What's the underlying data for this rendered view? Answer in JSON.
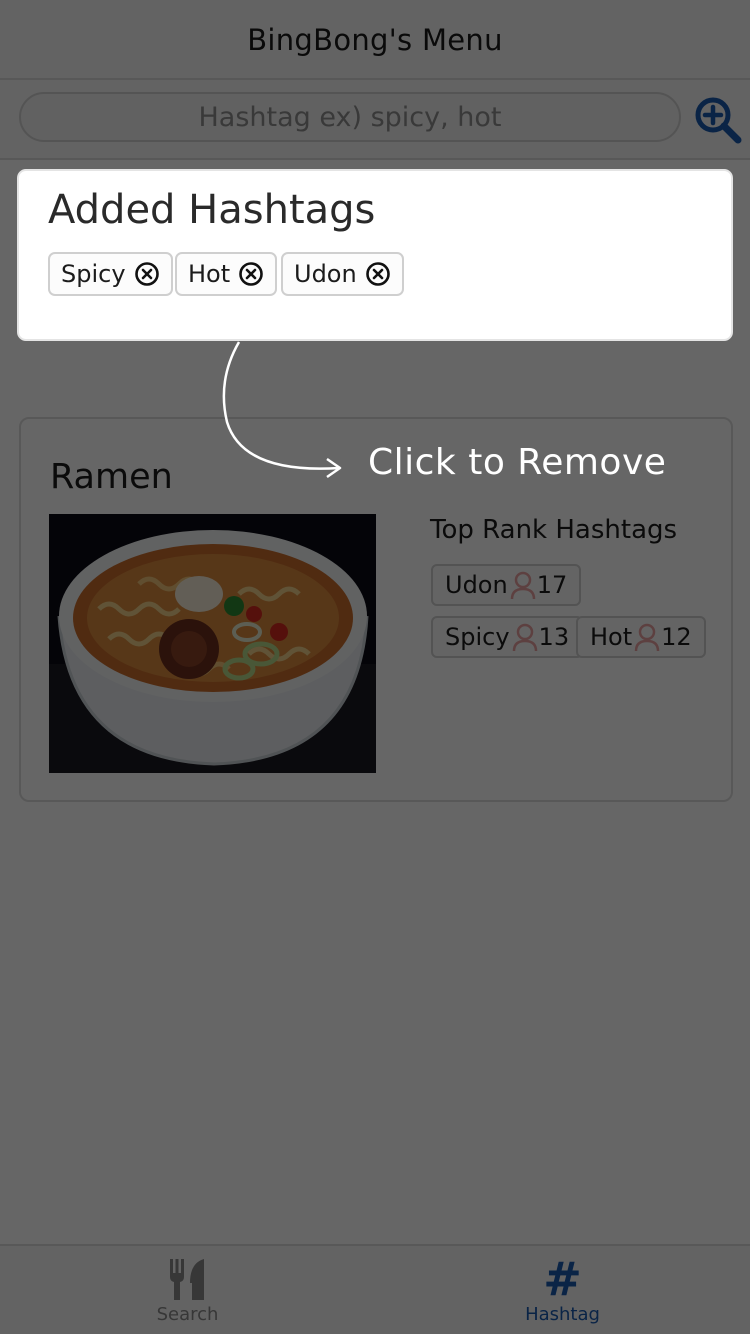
{
  "header": {
    "title": "BingBong's Menu"
  },
  "search": {
    "placeholder": "Hashtag ex) spicy, hot",
    "button_icon": "zoom-in-icon"
  },
  "added_hashtags": {
    "title": "Added Hashtags",
    "chips": [
      {
        "label": "Spicy"
      },
      {
        "label": "Hot"
      },
      {
        "label": "Udon"
      }
    ]
  },
  "coachmark": {
    "text": "Click to Remove"
  },
  "menu_card": {
    "title": "Ramen",
    "rank_heading": "Top Rank Hashtags",
    "rank_tags": [
      {
        "label": "Udon",
        "count": "17"
      },
      {
        "label": "Spicy",
        "count": "13"
      },
      {
        "label": "Hot",
        "count": "12"
      }
    ]
  },
  "tabs": [
    {
      "label": "Search",
      "icon": "fork-knife-icon"
    },
    {
      "label": "Hashtag",
      "icon": "hashtag-icon"
    }
  ],
  "colors": {
    "accent": "#1a5ab0",
    "overlay": "rgba(0,0,0,0.60)",
    "person_icon": "#e8a0a0"
  }
}
